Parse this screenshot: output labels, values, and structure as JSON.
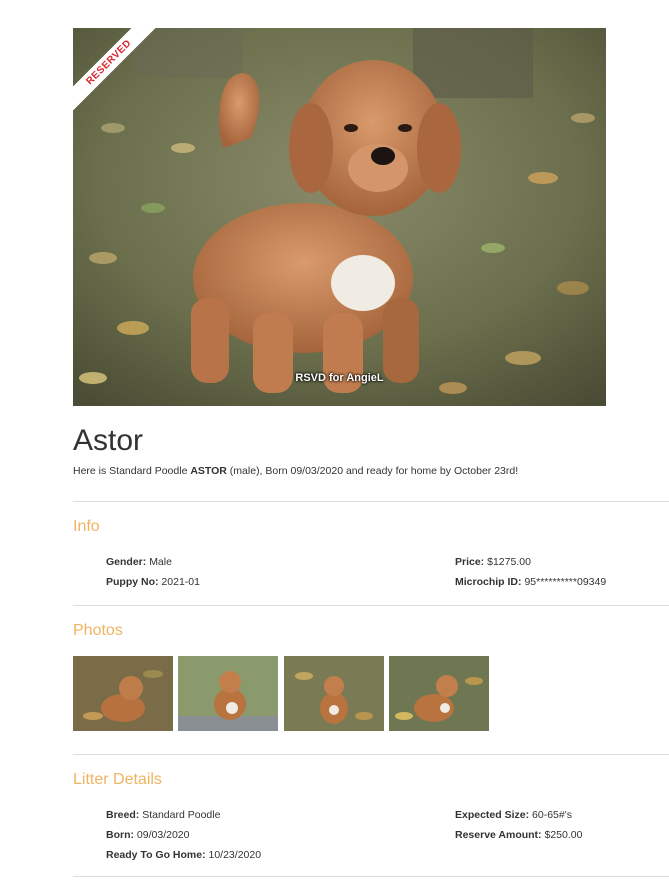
{
  "hero": {
    "badge": "RESERVED",
    "caption": "RSVD for AngieL"
  },
  "puppy": {
    "name": "Astor",
    "intro_before": "Here is Standard Poodle ",
    "intro_name": "ASTOR",
    "intro_after": " (male), Born 09/03/2020 and ready for home by October 23rd!"
  },
  "info": {
    "heading": "Info",
    "gender_label": "Gender:",
    "gender_value": "Male",
    "puppy_no_label": "Puppy No:",
    "puppy_no_value": "2021-01",
    "price_label": "Price:",
    "price_value": "$1275.00",
    "microchip_label": "Microchip ID:",
    "microchip_value": "95**********09349"
  },
  "photos": {
    "heading": "Photos"
  },
  "litter": {
    "heading": "Litter Details",
    "breed_label": "Breed:",
    "breed_value": "Standard Poodle",
    "born_label": "Born:",
    "born_value": "09/03/2020",
    "ready_label": "Ready To Go Home:",
    "ready_value": "10/23/2020",
    "size_label": "Expected Size:",
    "size_value": "60-65#'s",
    "reserve_label": "Reserve Amount:",
    "reserve_value": "$250.00"
  }
}
